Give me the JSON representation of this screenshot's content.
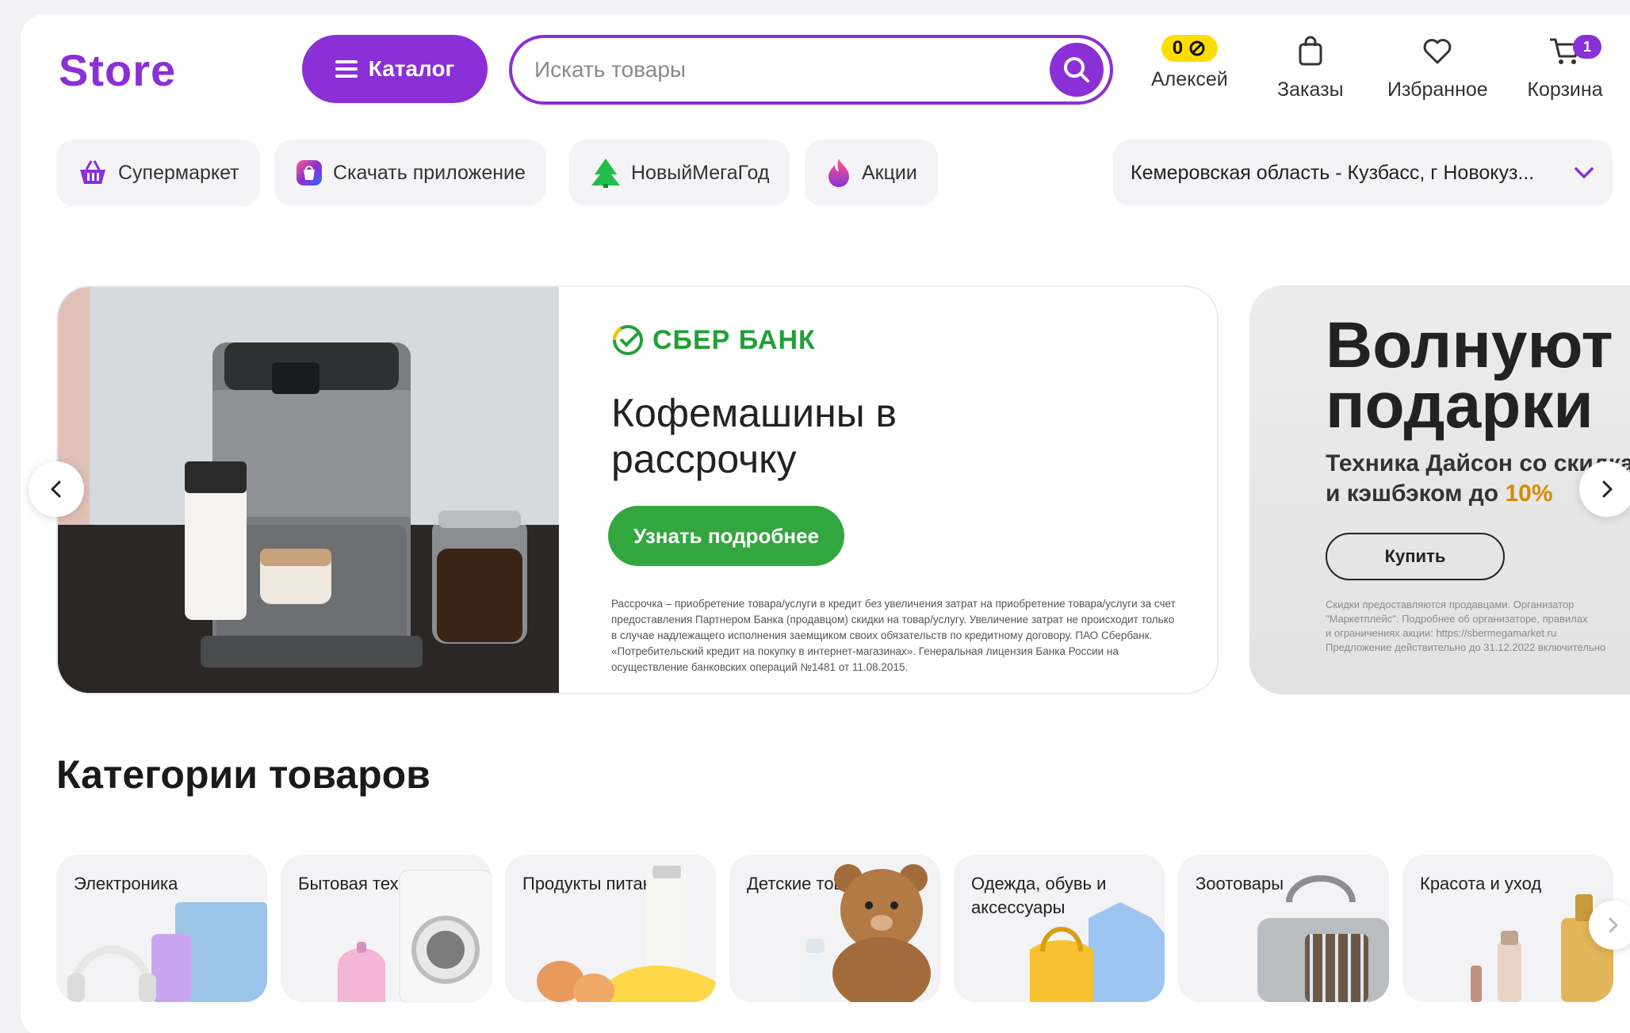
{
  "header": {
    "logo": "Store",
    "catalog_label": "Каталог",
    "search_placeholder": "Искать товары",
    "bonus_count": "0",
    "user_label": "Алексей",
    "orders_label": "Заказы",
    "favorites_label": "Избранное",
    "cart_label": "Корзина",
    "cart_count": "1"
  },
  "chips": [
    {
      "label": "Супермаркет",
      "icon": "basket-icon"
    },
    {
      "label": "Скачать приложение",
      "icon": "app-icon"
    },
    {
      "label": "НовыйМегаГод",
      "icon": "tree-icon"
    },
    {
      "label": "Акции",
      "icon": "fire-icon"
    }
  ],
  "region": "Кемеровская область - Кузбасс, г Новокуз...",
  "banner": {
    "brand": "СБЕР БАНК",
    "title": "Кофемашины в рассрочку",
    "button": "Узнать подробнее",
    "legal": "Рассрочка – приобретение товара/услуги в кредит без увеличения затрат на приобретение товара/услуги за счет предоставления Партнером Банка (продавцом) скидки на товар/услугу. Увеличение затрат не происходит только в случае надлежащего исполнения заемщиком своих обязательств по кредитному договору. ПАО Сбербанк. «Потребительский кредит на покупку в интернет-магазинах». Генеральная лицензия Банка России на осуществление банковских операций №1481 от 11.08.2015."
  },
  "banner2": {
    "title_line1": "Волнуют",
    "title_line2": "подарки",
    "sub_line1": "Техника Дайсон со скидками",
    "sub_line2_prefix": "и кэшбэком до ",
    "sub_line2_accent": "10%",
    "button": "Купить",
    "legal_line1": "Скидки предоставляются продавцами. Организатор",
    "legal_line2": "\"Маркетплейс\". Подробнее об организаторе, правилах",
    "legal_line3": "и ограничениях акции: https://sbermegamarket.ru",
    "legal_line4": "Предложение действительно до 31.12.2022 включительно"
  },
  "categories_title": "Категории товаров",
  "categories": [
    {
      "label": "Электроника"
    },
    {
      "label": "Бытовая техника"
    },
    {
      "label": "Продукты питания"
    },
    {
      "label": "Детские товары"
    },
    {
      "label": "Одежда, обувь и аксессуары"
    },
    {
      "label": "Зоотовары"
    },
    {
      "label": "Красота и уход"
    }
  ],
  "colors": {
    "brand": "#8b2fd6",
    "sber_green": "#21a038",
    "button_green": "#34a63f",
    "bonus_yellow": "#ffdd00"
  }
}
